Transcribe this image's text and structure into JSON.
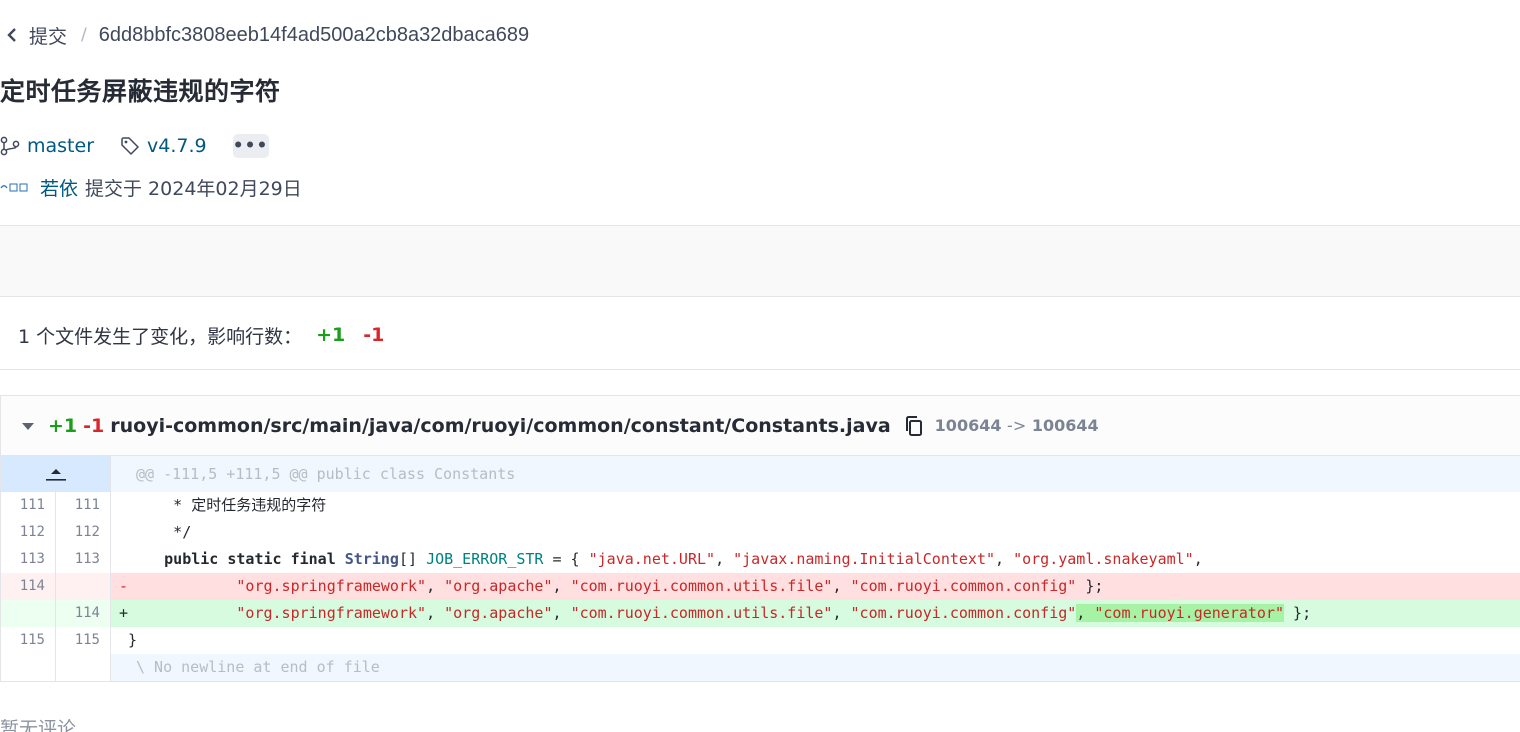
{
  "breadcrumb": {
    "back_label": "提交",
    "separator": "/",
    "commit_sha": "6dd8bbfc3808eeb14f4ad500a2cb8a32dbaca689"
  },
  "commit": {
    "title": "定时任务屏蔽违规的字符",
    "branch": "master",
    "tag": "v4.7.9",
    "more_label": "•••",
    "author": "若依",
    "meta": "提交于 2024年02月29日"
  },
  "summary": {
    "text": "1 个文件发生了变化，影响行数：",
    "additions": "+1",
    "deletions": "-1"
  },
  "file": {
    "additions": "+1",
    "deletions": "-1",
    "path": "ruoyi-common/src/main/java/com/ruoyi/common/constant/Constants.java",
    "mode_old": "100644",
    "mode_arrow": "->",
    "mode_new": "100644"
  },
  "diff": {
    "hunk_header": "@@ -111,5 +111,5 @@ public class Constants",
    "lines": [
      {
        "type": "context",
        "old": "111",
        "new": "111",
        "text": "      * 定时任务违规的字符"
      },
      {
        "type": "context",
        "old": "112",
        "new": "112",
        "text": "      */"
      },
      {
        "type": "context",
        "old": "113",
        "new": "113",
        "kw": "public static final",
        "ty": "String",
        "br": "[]",
        "cn": "JOB_ERROR_STR",
        "eq": " = { ",
        "strs": [
          "\"java.net.URL\"",
          "\"javax.naming.InitialContext\"",
          "\"org.yaml.snakeyaml\""
        ],
        "tail": ","
      },
      {
        "type": "del",
        "old": "114",
        "new": "",
        "marker": "-",
        "strs": [
          "\"org.springframework\"",
          "\"org.apache\"",
          "\"com.ruoyi.common.utils.file\"",
          "\"com.ruoyi.common.config\""
        ],
        "tail": " };"
      },
      {
        "type": "add",
        "old": "",
        "new": "114",
        "marker": "+",
        "strs": [
          "\"org.springframework\"",
          "\"org.apache\"",
          "\"com.ruoyi.common.utils.file\"",
          "\"com.ruoyi.common.config\""
        ],
        "added": "\"com.ruoyi.generator\"",
        "tail": " };"
      },
      {
        "type": "context",
        "old": "115",
        "new": "115",
        "text": " }"
      }
    ],
    "eof_text": "\\ No newline at end of file"
  },
  "comments": {
    "empty_text": "暂无评论"
  },
  "colors": {
    "link": "#005980",
    "addition": "#1b9f1b",
    "deletion": "#d9262c",
    "add_row_bg": "#d6fbde",
    "del_row_bg": "#ffdfdf",
    "hunk_bg": "#f0f7ff"
  },
  "icons": [
    "chevron-left-icon",
    "branch-icon",
    "tag-icon",
    "more-icon",
    "avatar-logo",
    "caret-down-icon",
    "copy-icon",
    "expand-up-icon"
  ]
}
